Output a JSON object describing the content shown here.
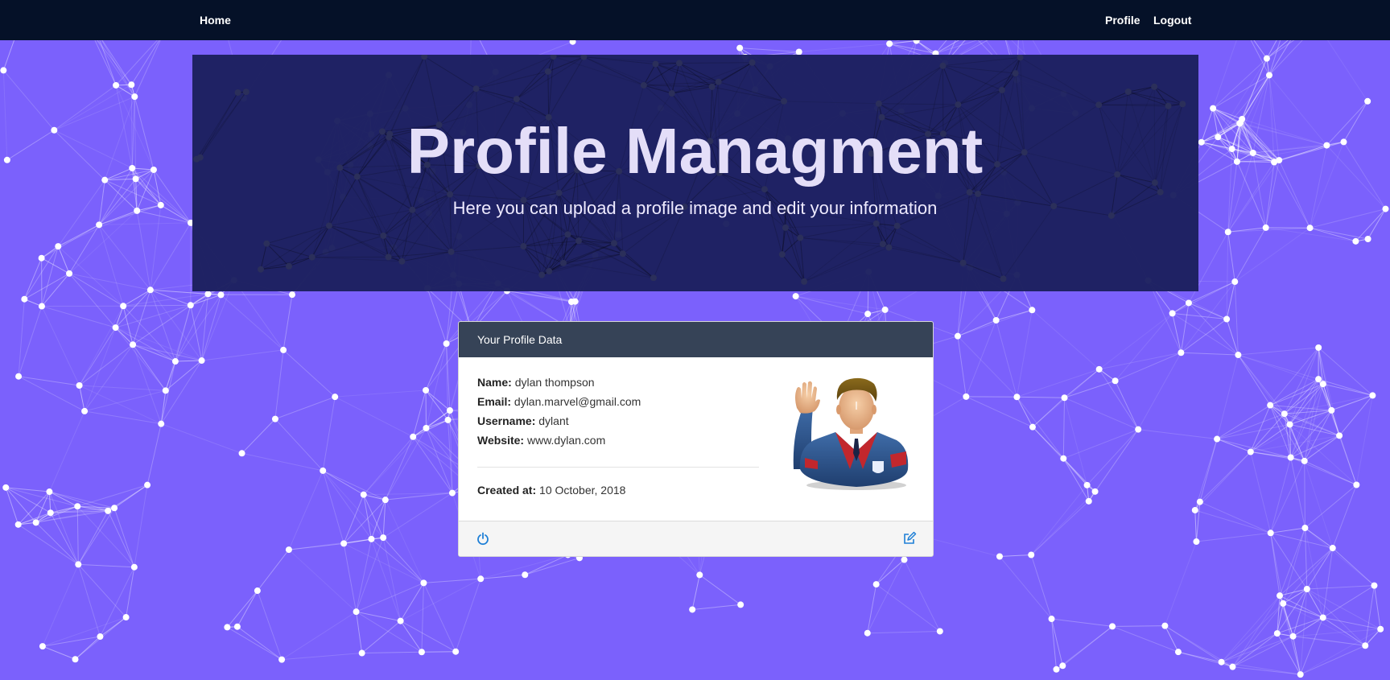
{
  "navbar": {
    "home_label": "Home",
    "profile_label": "Profile",
    "logout_label": "Logout"
  },
  "jumbotron": {
    "title": "Profile Managment",
    "subtitle": "Here you can upload a profile image and edit your information"
  },
  "profile_card": {
    "header": "Your Profile Data",
    "name_label": "Name:",
    "name_value": "dylan thompson",
    "email_label": "Email:",
    "email_value": "dylan.marvel@gmail.com",
    "username_label": "Username:",
    "username_value": "dylant",
    "website_label": "Website:",
    "website_value": "www.dylan.com",
    "created_label": "Created at:",
    "created_value": "10 October, 2018",
    "avatar_icon": "waving-man-avatar",
    "footer_left_icon": "power-icon",
    "footer_right_icon": "edit-icon"
  },
  "colors": {
    "background": "#7b61fc",
    "navbar": "#051128",
    "jumbotron": "#1c205f",
    "card_header": "#364357",
    "accent_icon": "#1e7fd6"
  }
}
